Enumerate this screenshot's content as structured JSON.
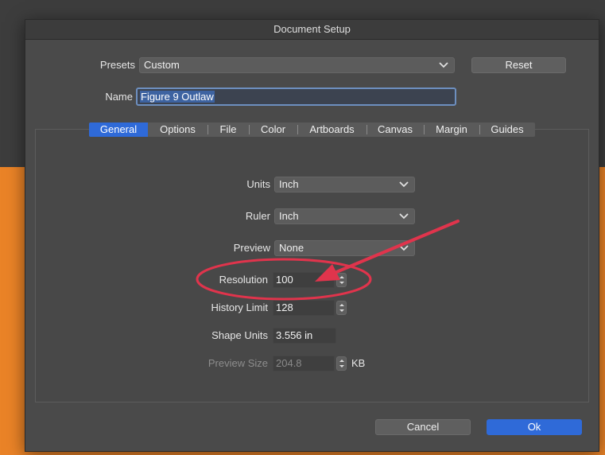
{
  "window": {
    "title": "Document Setup"
  },
  "presets": {
    "label": "Presets",
    "value": "Custom"
  },
  "reset_button": "Reset",
  "name": {
    "label": "Name",
    "value": "Figure 9 Outlaw"
  },
  "tabs": [
    {
      "label": "General",
      "active": true
    },
    {
      "label": "Options"
    },
    {
      "label": "File"
    },
    {
      "label": "Color"
    },
    {
      "label": "Artboards"
    },
    {
      "label": "Canvas"
    },
    {
      "label": "Margin"
    },
    {
      "label": "Guides"
    }
  ],
  "general": {
    "units": {
      "label": "Units",
      "value": "Inch"
    },
    "ruler": {
      "label": "Ruler",
      "value": "Inch"
    },
    "preview": {
      "label": "Preview",
      "value": "None"
    },
    "resolution": {
      "label": "Resolution",
      "value": "100"
    },
    "history_limit": {
      "label": "History Limit",
      "value": "128"
    },
    "shape_units": {
      "label": "Shape Units",
      "value": "3.556 in"
    },
    "preview_size": {
      "label": "Preview Size",
      "value": "204.8",
      "unit": "KB"
    }
  },
  "footer": {
    "cancel": "Cancel",
    "ok": "Ok"
  },
  "colors": {
    "accent": "#2f6ad8",
    "annotation": "#e0344c",
    "background_orange": "#ea8327"
  },
  "annotation": {
    "type": "circle-with-arrow",
    "target": "resolution"
  }
}
